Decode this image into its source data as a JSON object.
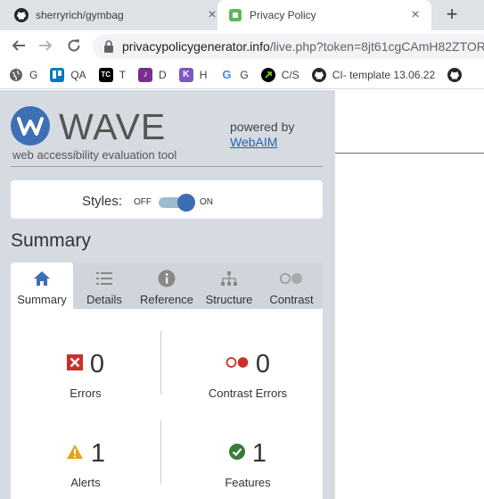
{
  "browser": {
    "tabs": [
      {
        "title": "sherryrich/gymbag",
        "icon": "github-icon",
        "active": false
      },
      {
        "title": "Privacy Policy",
        "icon": "page-favicon",
        "active": true
      }
    ],
    "new_tab_symbol": "+",
    "close_symbol": "×",
    "url": {
      "host": "privacypolicygenerator.info",
      "path": "/live.php?token=8jt61cgCAmH82ZTOR"
    },
    "bookmarks": [
      {
        "label": "G",
        "icon": "globe-icon"
      },
      {
        "label": "QA",
        "icon": "trello-icon"
      },
      {
        "label": "T",
        "icon": "tc-icon"
      },
      {
        "label": "D",
        "icon": "d-app-icon"
      },
      {
        "label": "H",
        "icon": "h-app-icon"
      },
      {
        "label": "G",
        "icon": "google-icon"
      },
      {
        "label": "C/S",
        "icon": "cs-icon"
      },
      {
        "label": "CI- template 13.06.22",
        "icon": "github-icon"
      },
      {
        "label": "",
        "icon": "github-icon"
      }
    ]
  },
  "wave": {
    "logo_text": "WAVE",
    "tagline": "web accessibility evaluation tool",
    "powered_by": "powered by",
    "webaim_link": "WebAIM",
    "styles": {
      "label": "Styles:",
      "off": "OFF",
      "on": "ON",
      "state": "on"
    },
    "summary_heading": "Summary",
    "tabs": [
      {
        "label": "Summary",
        "icon": "home-icon",
        "active": true
      },
      {
        "label": "Details",
        "icon": "list-icon",
        "active": false
      },
      {
        "label": "Reference",
        "icon": "info-icon",
        "active": false
      },
      {
        "label": "Structure",
        "icon": "sitemap-icon",
        "active": false
      },
      {
        "label": "Contrast",
        "icon": "contrast-icon",
        "active": false
      }
    ],
    "stats": {
      "errors": {
        "count": "0",
        "label": "Errors",
        "color": "#c9302c"
      },
      "contrast_errors": {
        "count": "0",
        "label": "Contrast Errors",
        "color": "#c9302c"
      },
      "alerts": {
        "count": "1",
        "label": "Alerts",
        "color": "#e6a117"
      },
      "features": {
        "count": "1",
        "label": "Features",
        "color": "#3a8a3a"
      }
    },
    "accent": "#3d6fb4"
  }
}
